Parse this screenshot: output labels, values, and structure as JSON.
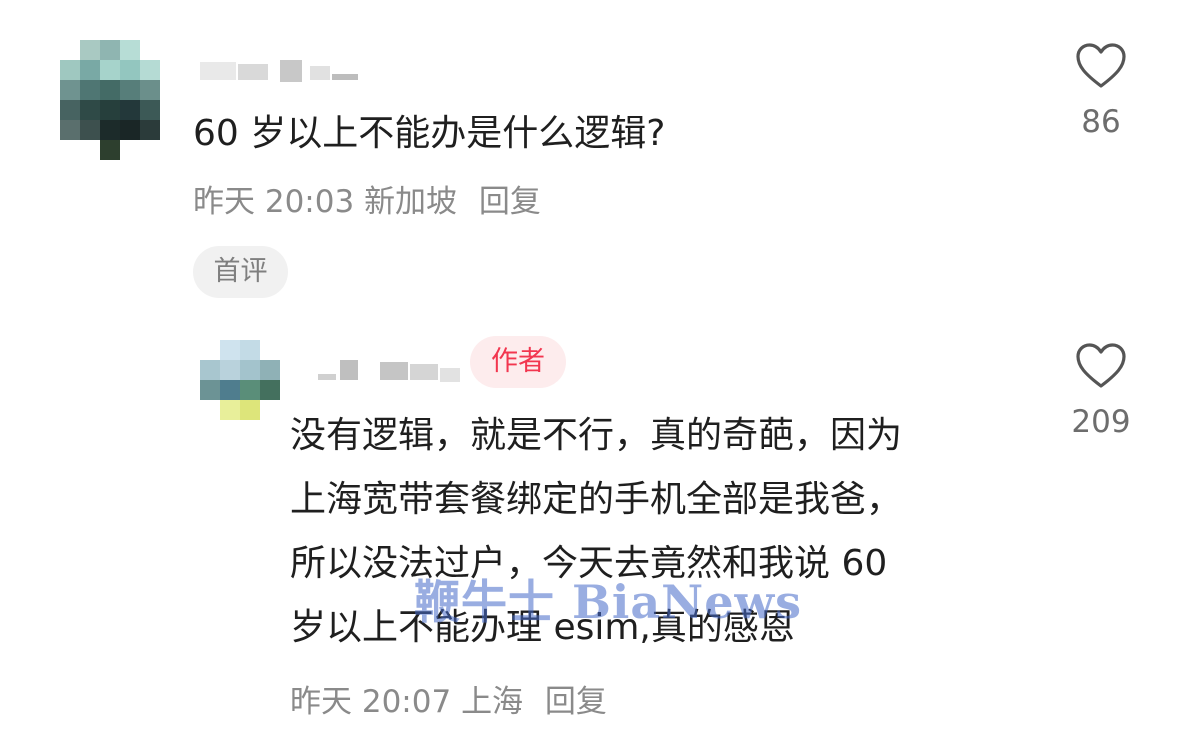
{
  "comment": {
    "text": "60 岁以上不能办是什么逻辑?",
    "time": "昨天 20:03",
    "location": "新加坡",
    "reply_label": "回复",
    "badge": "首评",
    "likes": "86",
    "avatar_colors": [
      "#ffffff",
      "#a9c9c2",
      "#8fb5b1",
      "#b7ddd6",
      "#ffffff",
      "#9fc8c0",
      "#79a9a5",
      "#a6d3cb",
      "#93c6bf",
      "#b5dbd4",
      "#6f9390",
      "#4f7673",
      "#446b66",
      "#577e7a",
      "#6b8f8b",
      "#476361",
      "#2f4a47",
      "#263f3c",
      "#23383a",
      "#3c5956",
      "#5a6f6d",
      "#3d504e",
      "#1c2b2a",
      "#1a2626",
      "#2b3b3a",
      "#ffffff",
      "#ffffff",
      "#2d3f2e",
      "#ffffff",
      "#ffffff"
    ]
  },
  "reply": {
    "badge": "作者",
    "lines": [
      "没有逻辑，就是不行，真的奇葩，因为",
      "上海宽带套餐绑定的手机全部是我爸，",
      "所以没法过户，今天去竟然和我说 60",
      "岁以上不能办理 esim,真的感恩"
    ],
    "time": "昨天 20:07",
    "location": "上海",
    "reply_label": "回复",
    "likes": "209",
    "avatar_colors": [
      "#ffffff",
      "#cfe3ee",
      "#c3dbe6",
      "#ffffff",
      "#a8c6cf",
      "#b9d2dc",
      "#a3c3cc",
      "#8fb1b6",
      "#6c9395",
      "#4f7d8e",
      "#5a8e79",
      "#44705e",
      "#ffffff",
      "#e8ef9a",
      "#dde57a",
      "#ffffff"
    ]
  },
  "watermark": "鞭牛士 BiaNews"
}
